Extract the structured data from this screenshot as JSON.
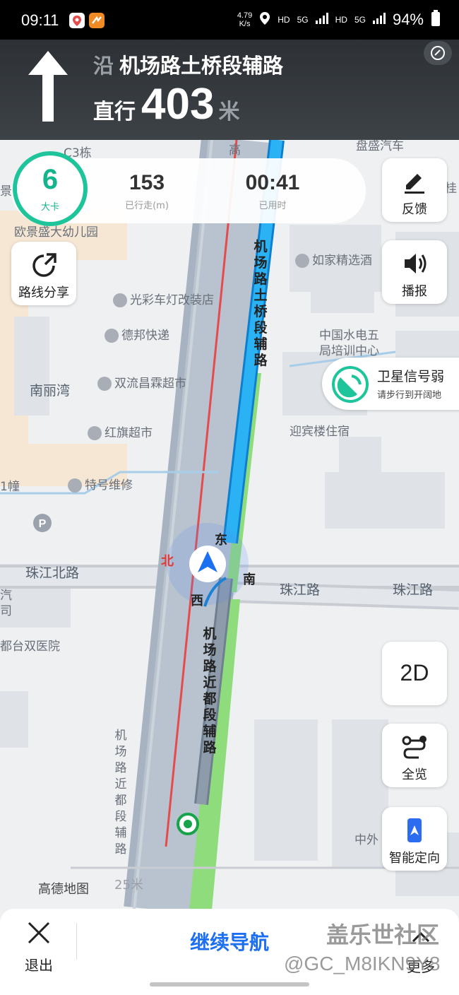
{
  "status_bar": {
    "time": "09:11",
    "net_speed": "4.79",
    "net_unit": "K/s",
    "hd1": "HD",
    "sig1": "5G",
    "hd2": "HD",
    "sig2": "5G",
    "battery": "94%"
  },
  "nav_banner": {
    "road_prefix": "沿",
    "road_name": "机场路土桥段辅路",
    "action": "直行",
    "distance": "403",
    "unit": "米"
  },
  "speed_limit": {
    "value": "6",
    "label": "大卡"
  },
  "stats": [
    {
      "value": "153",
      "label": "已行走(m)"
    },
    {
      "value": "00:41",
      "label": "已用时"
    }
  ],
  "side_buttons": {
    "feedback": "反馈",
    "broadcast": "播报",
    "route_share": "路线分享",
    "view_2d": "2D",
    "overview": "全览",
    "smart_orient": "智能定向"
  },
  "toast": {
    "title": "卫星信号弱",
    "subtitle": "请步行到开阔地"
  },
  "map": {
    "labels": {
      "c3": "C3栋",
      "gao": "高",
      "panshengqiche": "盘盛汽车",
      "jing": "景",
      "gui": "桂",
      "kindergarten": "欧景盛大幼儿园",
      "rujia": "如家精选酒",
      "guangcai": "光彩车灯改装店",
      "debang": "德邦快递",
      "zhongguo1": "中国水电五",
      "zhongguo2": "局培训中心",
      "nanliwan": "南丽湾",
      "shuangliu": "双流昌霖超市",
      "yingbin": "迎宾楼住宿",
      "hongqi": "红旗超市",
      "tehao": "特号维修",
      "tong": "1幢",
      "zhujiang_n": "珠江北路",
      "zhujiang1": "珠江路",
      "zhujiang2": "珠江路",
      "qi": "汽",
      "si": "司",
      "hospital": "都台双医院",
      "zhongwai": "中外",
      "road_main": "机场路土桥段辅路",
      "road_lower": "机场路近都段辅路",
      "road_left": "机场路近都段辅路",
      "east": "东",
      "south": "南",
      "west": "西",
      "north": "北",
      "logo": "高德地图",
      "scale": "25米"
    }
  },
  "bottom_bar": {
    "exit": "退出",
    "continue": "继续导航",
    "more": "更多"
  },
  "watermark": {
    "line1": "盖乐世社区",
    "line2": "@GC_M8IKN9Y8"
  },
  "colors": {
    "route": "#1aa7f0",
    "limit": "#1fc59a",
    "accent": "#1d6ff2",
    "park": "#8fdc7c"
  }
}
